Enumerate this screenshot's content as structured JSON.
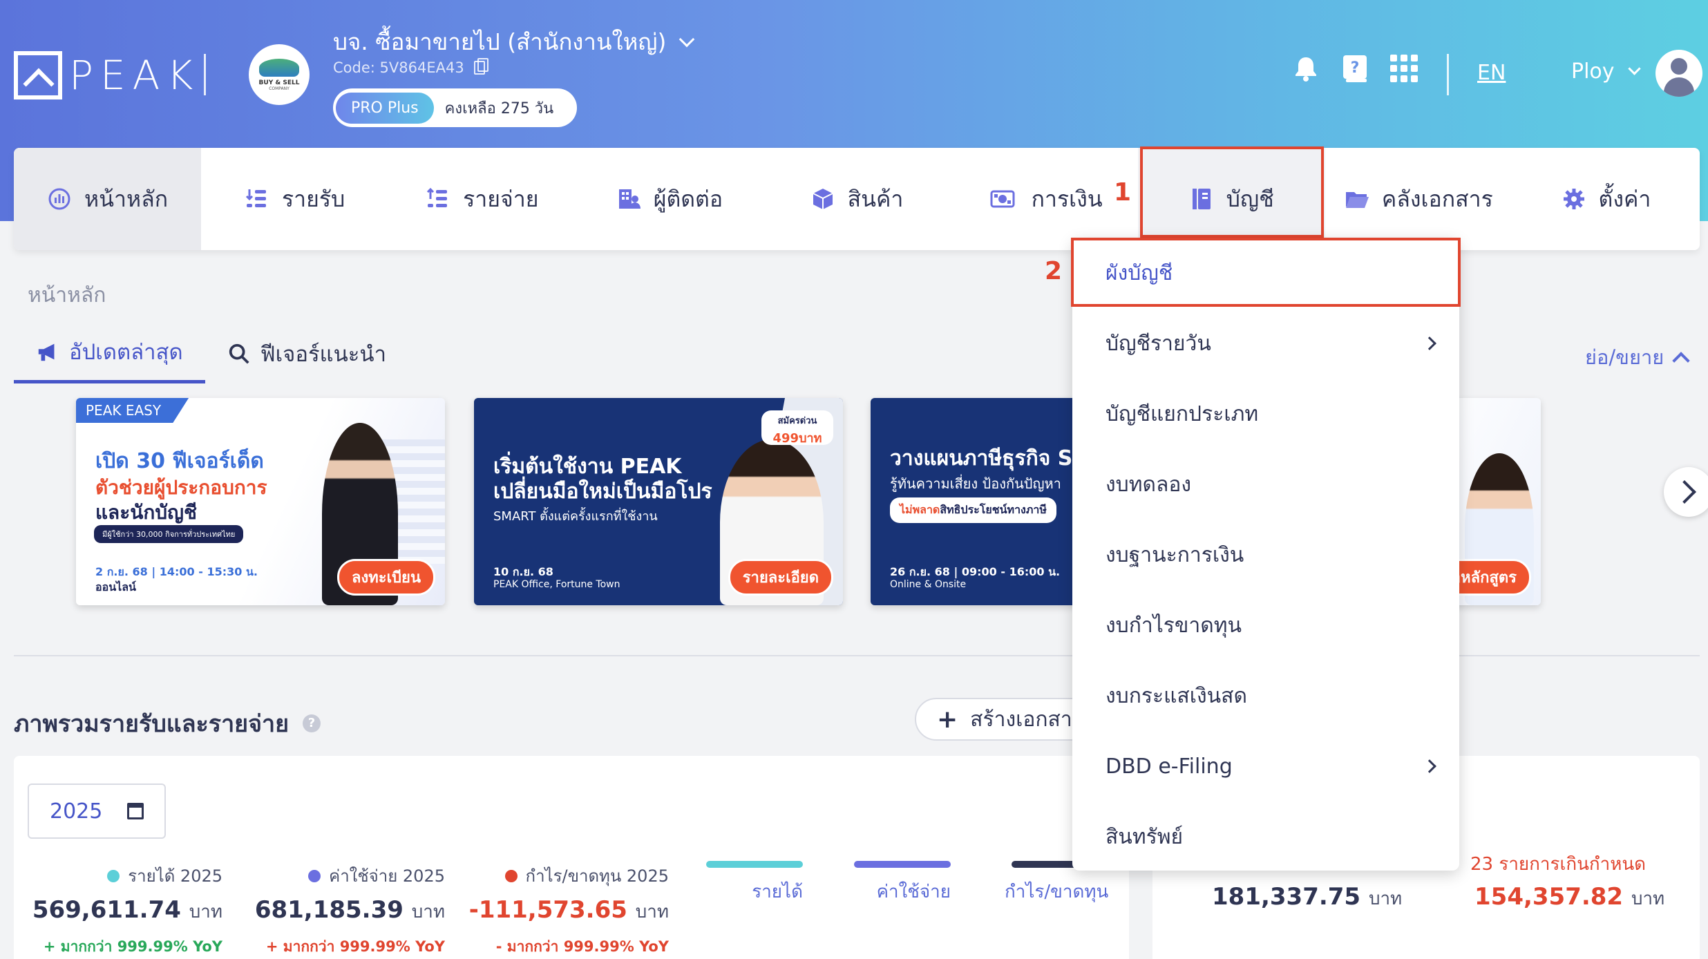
{
  "header": {
    "logo_text": "PEAK",
    "company_logo_line1": "BUY & SELL",
    "company_logo_line2": "COMPANY",
    "company_name": "บจ. ซื้อมาขายไป (สำนักงานใหญ่)",
    "company_code": "Code: 5V864EA43",
    "plan_badge": "PRO Plus",
    "plan_days": "คงเหลือ 275 วัน",
    "language": "EN",
    "user_name": "Ploy"
  },
  "nav": {
    "items": [
      {
        "label": "หน้าหลัก",
        "icon": "dashboard-icon"
      },
      {
        "label": "รายรับ",
        "icon": "income-icon"
      },
      {
        "label": "รายจ่าย",
        "icon": "expense-icon"
      },
      {
        "label": "ผู้ติดต่อ",
        "icon": "contacts-icon"
      },
      {
        "label": "สินค้า",
        "icon": "product-box-icon"
      },
      {
        "label": "การเงิน",
        "icon": "money-icon"
      },
      {
        "label": "บัญชี",
        "icon": "accounting-book-icon"
      },
      {
        "label": "คลังเอกสาร",
        "icon": "folder-icon"
      },
      {
        "label": "ตั้งค่า",
        "icon": "gear-icon"
      }
    ],
    "step1": "1",
    "step2": "2"
  },
  "breadcrumb": "หน้าหลัก",
  "tabs": {
    "updates": "อัปเดตล่าสุด",
    "features": "ฟีเจอร์แนะนำ",
    "expand": "ย่อ/ขยาย"
  },
  "banners": {
    "b1": {
      "tag": "PEAK EASY",
      "line1": "เปิด 30 ฟีเจอร์เด็ด",
      "line2": "ตัวช่วยผู้ประกอบการ",
      "line3": "และนักบัญชี",
      "pill": "มีผู้ใช้กว่า 30,000 กิจการทั่วประเทศไทย",
      "date": "2 ก.ย. 68 | 14:00 - 15:30 น.",
      "place": "ออนไลน์",
      "cta": "ลงทะเบียน"
    },
    "b2": {
      "promo_top": "สมัครด่วน",
      "promo_price": "499บาท",
      "line1": "เริ่มต้นใช้งาน PEAK",
      "line2": "เปลี่ยนมือใหม่เป็นมือโปร",
      "line3": "SMART ตั้งแต่ครั้งแรกที่ใช้งาน",
      "date": "10 ก.ย. 68",
      "place": "PEAK Office, Fortune Town",
      "cta": "รายละเอียด"
    },
    "b3": {
      "line1": "วางแผนภาษีธุรกิจ S",
      "line2": "รู้ทันความเสี่ยง ป้องกันปัญหา",
      "pill_red": "ไม่พลาด",
      "pill_rest": "สิทธิประโยชน์ทางภาษี",
      "date": "26 ก.ย. 68 | 09:00 - 16:00 น.",
      "place": "Online & Onsite"
    },
    "b4": {
      "cta": "ค้นหาหลักสูตร"
    }
  },
  "overview": {
    "title": "ภาพรวมรายรับและรายจ่าย",
    "create_button": "สร้างเอกสาร",
    "year": "2025",
    "stats": [
      {
        "label": "รายได้ 2025",
        "value": "569,611.74",
        "unit": "บาท",
        "yoy": "+ มากกว่า 999.99% YoY",
        "color": "#5ccfd8",
        "value_color": "#2f3553",
        "yoy_color": "#29a85a"
      },
      {
        "label": "ค่าใช้จ่าย 2025",
        "value": "681,185.39",
        "unit": "บาท",
        "yoy": "+ มากกว่า 999.99% YoY",
        "color": "#6b6fe0",
        "value_color": "#2f3553",
        "yoy_color": "#e0452f"
      },
      {
        "label": "กำไร/ขาดทุน 2025",
        "value": "-111,573.65",
        "unit": "บาท",
        "yoy": "- มากกว่า 999.99% YoY",
        "color": "#e0452f",
        "value_color": "#e0452f",
        "yoy_color": "#e0452f"
      }
    ],
    "legend": [
      {
        "label": "รายได้",
        "color": "#5ccfd8"
      },
      {
        "label": "ค่าใช้จ่าย",
        "color": "#6b6fe0"
      },
      {
        "label": "กำไร/ขาดทุน",
        "color": "#2f3553"
      }
    ],
    "panel2": {
      "label_overdue": "23 รายการเกินกำหนด",
      "value_left": "181,337.75",
      "value_right": "154,357.82",
      "unit": "บาท"
    }
  },
  "dropdown": {
    "items": [
      {
        "label": "ผังบัญชี",
        "submenu": false
      },
      {
        "label": "บัญชีรายวัน",
        "submenu": true
      },
      {
        "label": "บัญชีแยกประเภท",
        "submenu": false
      },
      {
        "label": "งบทดลอง",
        "submenu": false
      },
      {
        "label": "งบฐานะการเงิน",
        "submenu": false
      },
      {
        "label": "งบกำไรขาดทุน",
        "submenu": false
      },
      {
        "label": "งบกระแสเงินสด",
        "submenu": false
      },
      {
        "label": "DBD e-Filing",
        "submenu": true
      },
      {
        "label": "สินทรัพย์",
        "submenu": false
      }
    ]
  },
  "colors": {
    "accent": "#4655c8",
    "highlight": "#e0452f",
    "header_start": "#5b74db",
    "header_end": "#5dcfe2"
  }
}
